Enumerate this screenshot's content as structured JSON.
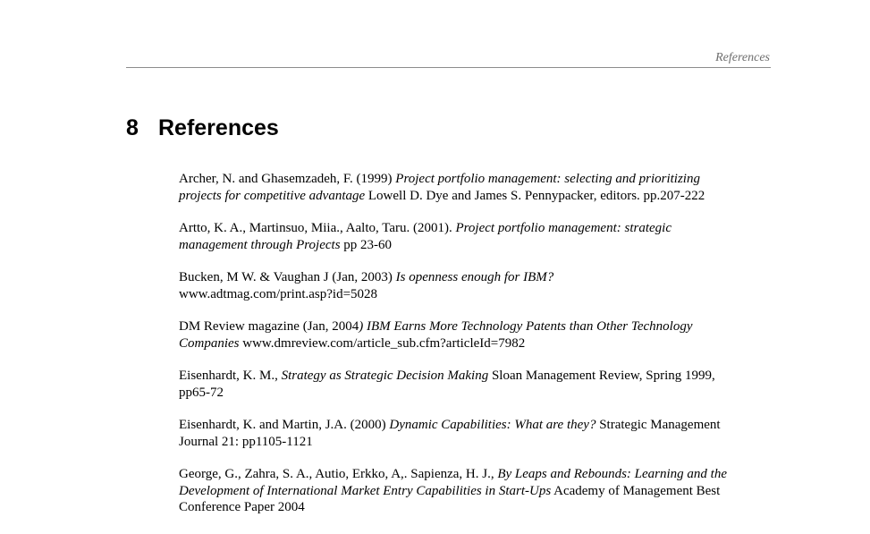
{
  "running_header": "References",
  "section": {
    "number": "8",
    "title": "References"
  },
  "references": [
    {
      "lines": [
        [
          {
            "t": "Archer, N. and Ghasemzadeh, F. (1999) ",
            "i": false
          },
          {
            "t": "Project portfolio management: selecting and prioritizing",
            "i": true
          }
        ],
        [
          {
            "t": "projects for competitive advantage",
            "i": true
          },
          {
            "t": " Lowell D. Dye and James S. Pennypacker, editors. pp.207-222",
            "i": false
          }
        ]
      ]
    },
    {
      "lines": [
        [
          {
            "t": "Artto, K. A., Martinsuo, Miia., Aalto, Taru. (2001). ",
            "i": false
          },
          {
            "t": "Project portfolio management: strategic",
            "i": true
          }
        ],
        [
          {
            "t": "management through Projects",
            "i": true
          },
          {
            "t": " pp 23-60",
            "i": false
          }
        ]
      ]
    },
    {
      "lines": [
        [
          {
            "t": "Bucken, M W. & Vaughan J (Jan, 2003) ",
            "i": false
          },
          {
            "t": "Is openness enough for IBM?",
            "i": true
          }
        ],
        [
          {
            "t": "www.adtmag.com/print.asp?id=5028",
            "i": false
          }
        ]
      ]
    },
    {
      "lines": [
        [
          {
            "t": "DM Review magazine (Jan, 2004",
            "i": false
          },
          {
            "t": ") IBM Earns More Technology Patents than Other Technology",
            "i": true
          }
        ],
        [
          {
            "t": "Companies",
            "i": true
          },
          {
            "t": " www.dmreview.com/article_sub.cfm?articleId=7982",
            "i": false
          }
        ]
      ]
    },
    {
      "lines": [
        [
          {
            "t": "Eisenhardt, K. M., ",
            "i": false
          },
          {
            "t": "Strategy as Strategic Decision Making",
            "i": true
          },
          {
            "t": " Sloan Management Review, Spring 1999,",
            "i": false
          }
        ],
        [
          {
            "t": "pp65-72",
            "i": false
          }
        ]
      ]
    },
    {
      "lines": [
        [
          {
            "t": "Eisenhardt, K. and Martin, J.A. (2000) ",
            "i": false
          },
          {
            "t": "Dynamic Capabilities: What are they?",
            "i": true
          },
          {
            "t": " Strategic Management",
            "i": false
          }
        ],
        [
          {
            "t": "Journal 21: pp1105-1121",
            "i": false
          }
        ]
      ]
    },
    {
      "lines": [
        [
          {
            "t": "George, G., Zahra, S. A., Autio, Erkko, A,. Sapienza, H. J., ",
            "i": false
          },
          {
            "t": "By Leaps and Rebounds: Learning and the",
            "i": true
          }
        ],
        [
          {
            "t": "Development of International Market Entry Capabilities in Start-Ups",
            "i": true
          },
          {
            "t": " Academy of Management Best",
            "i": false
          }
        ],
        [
          {
            "t": "Conference Paper 2004",
            "i": false
          }
        ]
      ]
    }
  ]
}
